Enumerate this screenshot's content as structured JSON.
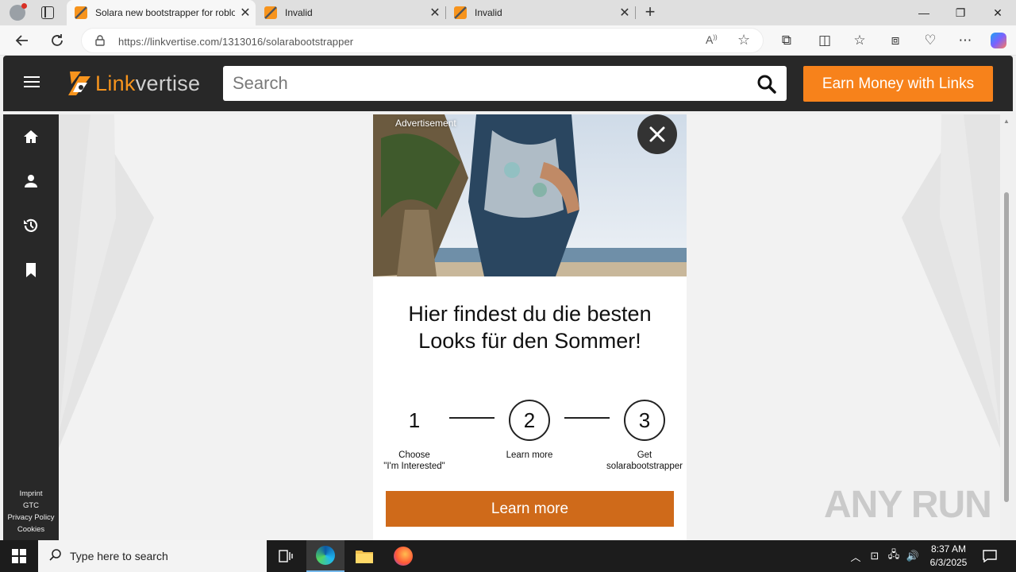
{
  "browser": {
    "tabs": [
      {
        "title": "Solara new bootstrapper for roblox",
        "active": true
      },
      {
        "title": "Invalid",
        "active": false
      },
      {
        "title": "Invalid",
        "active": false
      }
    ],
    "url": "https://linkvertise.com/1313016/solarabootstrapper"
  },
  "header": {
    "logo_part1": "Link",
    "logo_part2": "vertise",
    "search_placeholder": "Search",
    "earn_button": "Earn Money with Links"
  },
  "footer_links": [
    "Imprint",
    "GTC",
    "Privacy Policy",
    "Cookies"
  ],
  "ad": {
    "label": "Advertisement",
    "headline_line1": "Hier findest du die besten",
    "headline_line2": "Looks für den Sommer!"
  },
  "steps": [
    {
      "number": "1",
      "label_line1": "Choose",
      "label_line2": "\"I'm Interested\""
    },
    {
      "number": "2",
      "label_line1": "Learn more",
      "label_line2": ""
    },
    {
      "number": "3",
      "label_line1": "Get",
      "label_line2": "solarabootstrapper"
    }
  ],
  "cta_button": "Learn more",
  "watermark": "ANY RUN",
  "taskbar": {
    "search_placeholder": "Type here to search",
    "time": "8:37 AM",
    "date": "6/3/2025"
  },
  "colors": {
    "brand_orange": "#f7821b",
    "cta_orange": "#cf6a1a",
    "header_dark": "#282828"
  }
}
